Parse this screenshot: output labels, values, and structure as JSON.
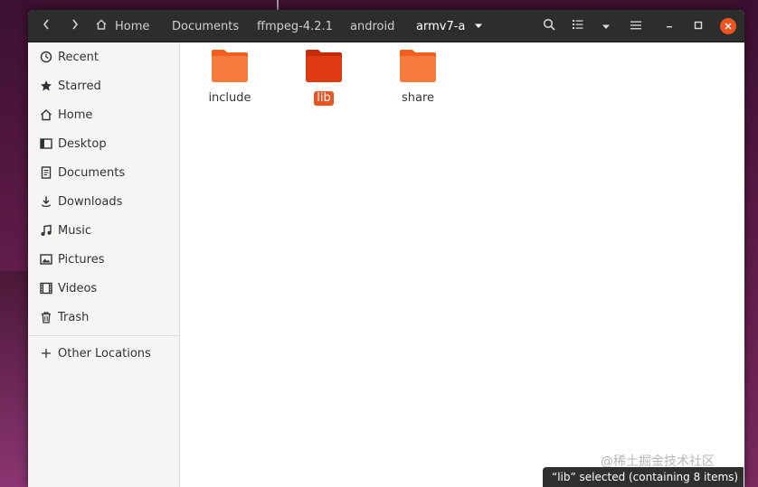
{
  "headerbar": {
    "breadcrumbs": [
      "Home",
      "Documents",
      "ffmpeg-4.2.1",
      "android",
      "armv7-a"
    ],
    "icons": {
      "back": "chevron-left-icon",
      "forward": "chevron-right-icon",
      "home": "home-icon",
      "dropdown": "chevron-down-icon",
      "search": "search-icon",
      "view": "list-view-icon",
      "view_menu": "chevron-down-icon",
      "menu": "hamburger-icon",
      "minimize": "minimize-icon",
      "maximize": "maximize-icon",
      "close": "close-icon"
    }
  },
  "sidebar": {
    "items": [
      {
        "label": "Recent",
        "icon": "clock-icon"
      },
      {
        "label": "Starred",
        "icon": "star-icon"
      },
      {
        "label": "Home",
        "icon": "home-icon"
      },
      {
        "label": "Desktop",
        "icon": "desktop-icon"
      },
      {
        "label": "Documents",
        "icon": "document-icon"
      },
      {
        "label": "Downloads",
        "icon": "download-icon"
      },
      {
        "label": "Music",
        "icon": "music-icon"
      },
      {
        "label": "Pictures",
        "icon": "picture-icon"
      },
      {
        "label": "Videos",
        "icon": "video-icon"
      },
      {
        "label": "Trash",
        "icon": "trash-icon"
      }
    ],
    "other_locations": {
      "label": "Other Locations",
      "icon": "plus-icon"
    }
  },
  "files": [
    {
      "name": "include",
      "selected": false
    },
    {
      "name": "lib",
      "selected": true
    },
    {
      "name": "share",
      "selected": false
    }
  ],
  "colors": {
    "accent": "#e95420",
    "folder": "#f57b3f",
    "folder_selected": "#df3b13",
    "headerbar": "#2d2d2d"
  },
  "status": "“lib” selected  (containing 8 items)",
  "watermark": "@稀土掘金技术社区"
}
